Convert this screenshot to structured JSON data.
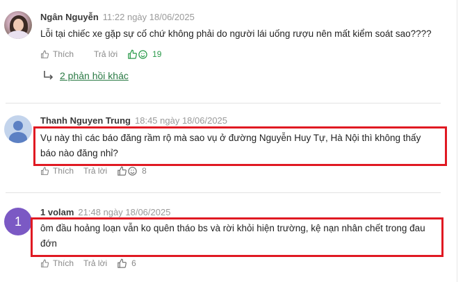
{
  "comments": [
    {
      "author": "Ngân Nguyễn",
      "time": "11:22 ngày 18/06/2025",
      "content": "Lỗi tại chiếc xe gặp sự cố chứ không phải do người lái uống rượu nên mất kiểm soát sao????",
      "like_label": "Thích",
      "reply_label": "Trả lời",
      "reaction_count": "19",
      "more_replies": "2 phản hồi khác"
    },
    {
      "author": "Thanh Nguyen Trung",
      "time": "18:45 ngày 18/06/2025",
      "content": "Vụ này thì các báo đăng rầm rộ mà sao vụ ở đường Nguyễn Huy Tự, Hà Nội thì không thấy báo nào đăng nhỉ?",
      "like_label": "Thích",
      "reply_label": "Trả lời",
      "reaction_count": "8"
    },
    {
      "avatar_letter": "1",
      "author": "1 volam",
      "time": "21:48 ngày 18/06/2025",
      "content": "ôm đầu hoảng loạn vẫn ko quên tháo bs và rời khỏi hiện trường, kệ nạn nhân chết trong đau đớn",
      "like_label": "Thích",
      "reply_label": "Trả lời",
      "reaction_count": "6"
    }
  ],
  "colors": {
    "highlight": "#e01922",
    "link_green": "#2a7a44",
    "avatar_purple": "#7b59c4"
  },
  "icons": [
    "thumb-up-icon",
    "reply-icon",
    "reaction-like-icon",
    "reaction-haha-icon",
    "reply-arrow-icon"
  ]
}
